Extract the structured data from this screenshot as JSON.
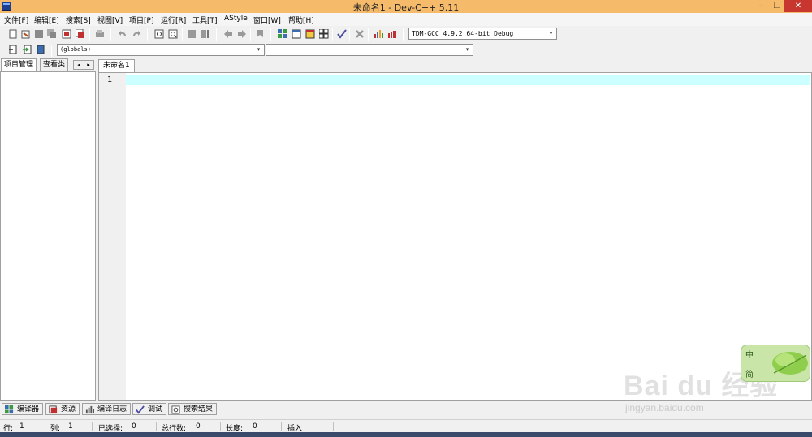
{
  "window": {
    "title": "未命名1 - Dev-C++ 5.11",
    "minimize": "–",
    "maximize": "❐",
    "close": "✕"
  },
  "menu": [
    "文件[F]",
    "编辑[E]",
    "搜索[S]",
    "视图[V]",
    "项目[P]",
    "运行[R]",
    "工具[T]",
    "AStyle",
    "窗口[W]",
    "帮助[H]"
  ],
  "toolbar": {
    "compiler_select": "TDM-GCC 4.9.2 64-bit Debug",
    "scope_select": "(globals)",
    "function_select": ""
  },
  "left_panel": {
    "tabs": [
      "项目管理",
      "查看类"
    ],
    "scroll_left": "◂",
    "scroll_right": "▸"
  },
  "editor": {
    "tab": "未命名1",
    "line_number": "1"
  },
  "bottom_tabs": [
    "编译器",
    "资源",
    "编译日志",
    "调试",
    "搜索结果"
  ],
  "status": {
    "row_label": "行:",
    "row_value": "1",
    "col_label": "列:",
    "col_value": "1",
    "sel_label": "已选择:",
    "sel_value": "0",
    "lines_label": "总行数:",
    "lines_value": "0",
    "len_label": "长度:",
    "len_value": "0",
    "mode": "插入"
  },
  "watermark": {
    "text": "Bai du 经验",
    "url": "jingyan.baidu.com",
    "badge_top": "中",
    "badge_bottom": "简"
  },
  "colors": {
    "titlebar": "#f5ba6a",
    "current_line": "#ccffff",
    "close_button": "#c7372f"
  }
}
